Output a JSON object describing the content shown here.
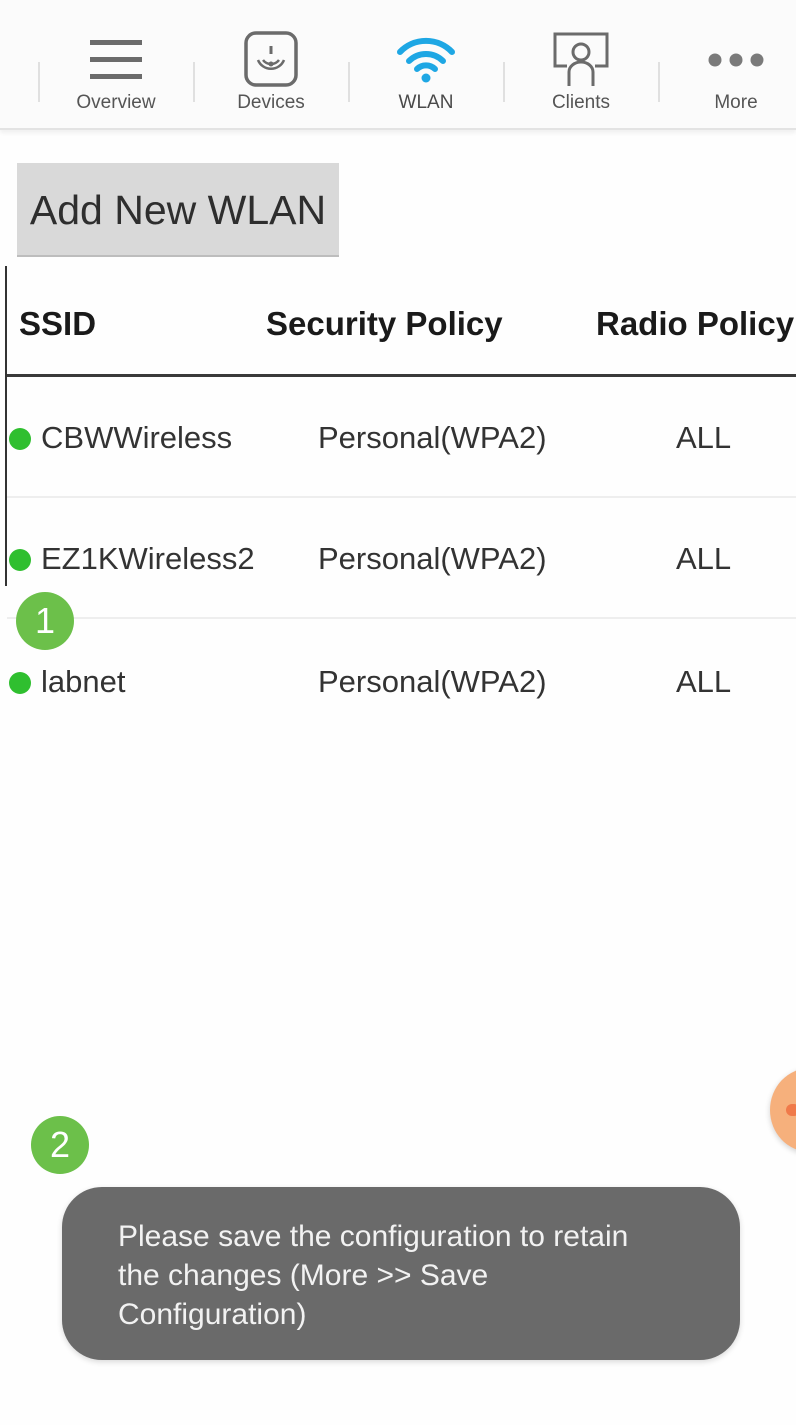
{
  "nav": {
    "items": [
      {
        "label": "Overview",
        "icon": "hamburger-menu-icon"
      },
      {
        "label": "Devices",
        "icon": "access-point-icon"
      },
      {
        "label": "WLAN",
        "icon": "wifi-icon"
      },
      {
        "label": "Clients",
        "icon": "client-user-icon"
      },
      {
        "label": "More",
        "icon": "more-dots-icon"
      }
    ],
    "active": "WLAN",
    "active_color": "#1ea7e4"
  },
  "add_button": {
    "label": "Add New WLAN"
  },
  "table": {
    "headers": [
      "SSID",
      "Security Policy",
      "Radio Policy"
    ],
    "rows": [
      {
        "ssid": "CBWWireless",
        "security": "Personal(WPA2)",
        "radio": "ALL"
      },
      {
        "ssid": "EZ1KWireless2",
        "security": "Personal(WPA2)",
        "radio": "ALL"
      },
      {
        "ssid": "labnet",
        "security": "Personal(WPA2)",
        "radio": "ALL"
      }
    ],
    "status_color": "#2fbf2f"
  },
  "badges": [
    "1",
    "2"
  ],
  "toast": {
    "message": "Please save the configuration to retain the changes (More >> Save Configuration)"
  },
  "colors": {
    "badge": "#6cc04a",
    "toast_bg": "#6a6a6a",
    "button_bg": "#d9d9d9",
    "fab": "#f6b07c"
  }
}
